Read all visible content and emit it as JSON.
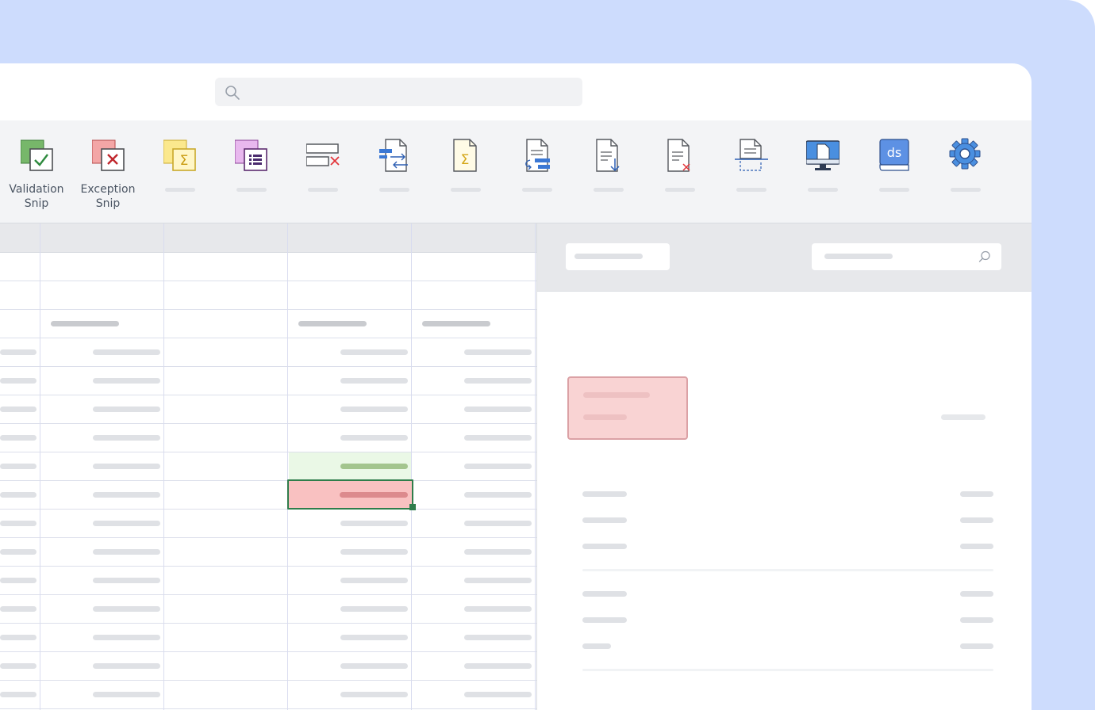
{
  "ribbon": {
    "validation_snip": {
      "line1": "Validation",
      "line2": "Snip",
      "icon": "validation-snip-icon"
    },
    "exception_snip": {
      "line1": "Exception",
      "line2": "Snip",
      "icon": "exception-snip-icon"
    },
    "unlabeled_icons": [
      "sum-snip-icon",
      "list-snip-icon",
      "delete-row-icon",
      "swap-columns-icon",
      "formula-document-icon",
      "document-convert-icon",
      "document-download-icon",
      "document-delete-icon",
      "document-clip-icon",
      "monitor-icon",
      "ds-book-icon",
      "gear-icon"
    ]
  },
  "colors": {
    "background": "#cddcfd",
    "ribbon": "#f3f4f6",
    "selected_cell_fill": "#f9c1c1",
    "selected_cell_border": "#2f7d4b",
    "valid_cell_fill": "#eaf8e6",
    "valid_bar": "#a3c58e",
    "error_bar": "#dc8a8d",
    "error_box_fill": "#f9d3d3"
  }
}
